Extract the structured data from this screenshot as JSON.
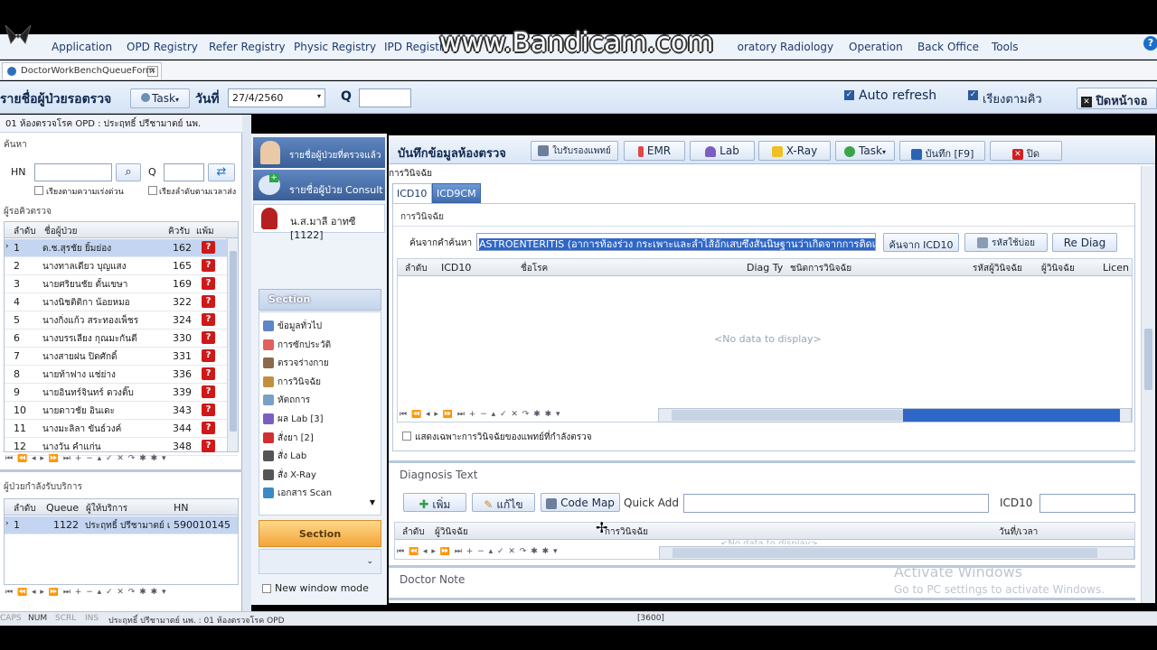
{
  "watermark": "www.Bandicam.com",
  "menu": [
    "Application",
    "OPD Registry",
    "Refer Registry",
    "Physic Registry",
    "IPD Registry",
    "Laboratory",
    "Radiology",
    "Operation",
    "Back Office",
    "Tools"
  ],
  "doc_tab": "DoctorWorkBenchQueueForm",
  "queue_bar": {
    "title": "รายชื่อผู้ป่วยรอตรวจ",
    "task": "Task",
    "date_label": "วันที่",
    "date": "27/4/2560",
    "q_label": "Q",
    "auto_refresh": "Auto refresh",
    "sort_queue": "เรียงตามคิว",
    "close_screen": "ปิดหน้าจอ"
  },
  "left": {
    "clinic": "01 ห้องตรวจโรค OPD : ประฤทธิ์ ปรีชามาตย์ นพ.",
    "search_group": "ค้นหา",
    "hn_label": "HN",
    "q_label": "Q",
    "sort_urgent": "เรียงตามความเร่งด่วน",
    "sort_time": "เรียงลำดับตามเวลาส่ง",
    "waiting_group": "ผู้รอคิวตรวจ",
    "cols": [
      "ลำดับ",
      "ชื่อผู้ป่วย",
      "คิวรับ",
      "แพ้ม"
    ],
    "patients": [
      {
        "no": "1",
        "name": "ด.ช.สุรชัย ยิ้มย่อง",
        "q": "162"
      },
      {
        "no": "2",
        "name": "นางทาลเดียว บุญแสง",
        "q": "165"
      },
      {
        "no": "3",
        "name": "นายศริยนชัย ตั้นเขษา",
        "q": "169"
      },
      {
        "no": "4",
        "name": "นางนิชติติกา น้อยหมอ",
        "q": "322"
      },
      {
        "no": "5",
        "name": "นางกิ่งแก้ว สระทองเพ็ชร",
        "q": "324"
      },
      {
        "no": "6",
        "name": "นางบรรเลียง กุณมะกันตี",
        "q": "330"
      },
      {
        "no": "7",
        "name": "นางสายฝน ปิดศักดิ์",
        "q": "331"
      },
      {
        "no": "8",
        "name": "นายท้าฟาง แช่ย่าง",
        "q": "336"
      },
      {
        "no": "9",
        "name": "นายอินทร์จินทร์ ดวงติ๊บ",
        "q": "339"
      },
      {
        "no": "10",
        "name": "นายดาวชัย อินเดะ",
        "q": "343"
      },
      {
        "no": "11",
        "name": "นางมะลิลา ขันธ์วงค์",
        "q": "344"
      },
      {
        "no": "12",
        "name": "นางวัน คำแก่น",
        "q": "348"
      }
    ],
    "receiving_group": "ผู้ป่วยกำลังรับบริการ",
    "recv_cols": [
      "ลำดับ",
      "Queue",
      "ผู้ให้บริการ",
      "HN"
    ],
    "receiving": [
      {
        "no": "1",
        "queue": "1122",
        "provider": "ประฤทธิ์ ปรีชามาตย์ เ",
        "hn": "590010145"
      }
    ]
  },
  "mid": {
    "nav": [
      "รายชื่อผู้ป่วยที่ตรวจแล้ว",
      "รายชื่อผู้ป่วย Consult"
    ],
    "patient": "น.ส.มาลี อาทซี [1122]",
    "section_title": "Section",
    "sections": [
      "ข้อมูลทั่วไป",
      "การซักประวัติ",
      "ตรวจร่างกาย",
      "การวินิจฉัย",
      "หัตถการ",
      "ผล Lab [3]",
      "สั่งยา [2]",
      "สั่ง Lab",
      "สั่ง X-Ray",
      "เอกสาร Scan"
    ],
    "section_btn": "Section",
    "new_window": "New window mode"
  },
  "toolbar": {
    "title": "บันทึกข้อมูลห้องตรวจ",
    "cert": "ใบรับรองแพทย์",
    "emr": "EMR",
    "lab": "Lab",
    "xray": "X-Ray",
    "task": "Task",
    "save": "บันทึก [F9]",
    "close": "ปิด"
  },
  "diag": {
    "group": "การวินิจฉัย",
    "tabs": [
      "ICD10",
      "ICD9CM"
    ],
    "sub": "การวินิจฉัย",
    "search_label": "ค้นจากคำค้นหา",
    "search_value": "ASTROENTERITIS (อาการท้องร่วง กระเพาะและลำไส้อักเสบซึ่งสันนิษฐานว่าเกิดจากการติดเชื้อ)",
    "btn_icd10": "ค้นจาก ICD10",
    "btn_freq": "รหัสใช้บ่อย",
    "btn_rediag": "Re Diag",
    "cols": [
      "ลำดับ",
      "ICD10",
      "ชื่อโรค",
      "Diag Ty",
      "ชนิดการวินิจฉัย",
      "รหัสผู้วินิจฉัย",
      "ผู้วินิจฉัย",
      "Licen"
    ],
    "empty": "<No data to display>",
    "only_mine": "แสดงเฉพาะการวินิจฉัยของแพทย์ที่กำลังตรวจ"
  },
  "diagtext": {
    "title": "Diagnosis Text",
    "add": "เพิ่ม",
    "edit": "แก้ไข",
    "codemap": "Code Map",
    "quick_add": "Quick Add",
    "icd10": "ICD10",
    "cols": [
      "ลำดับ",
      "ผู้วินิจฉัย",
      "การวินิจฉัย",
      "วันที่/เวลา"
    ],
    "empty": "<No data to display>"
  },
  "doctor_note": "Doctor Note",
  "activate": {
    "line1": "Activate Windows",
    "line2": "Go to PC settings to activate Windows."
  },
  "status": {
    "caps": "CAPS",
    "num": "NUM",
    "scrl": "SCRL",
    "ins": "INS",
    "user": "ประฤทธิ์ ปรีชามาตย์ นพ. : 01 ห้องตรวจโรค OPD",
    "code": "[3600]"
  }
}
